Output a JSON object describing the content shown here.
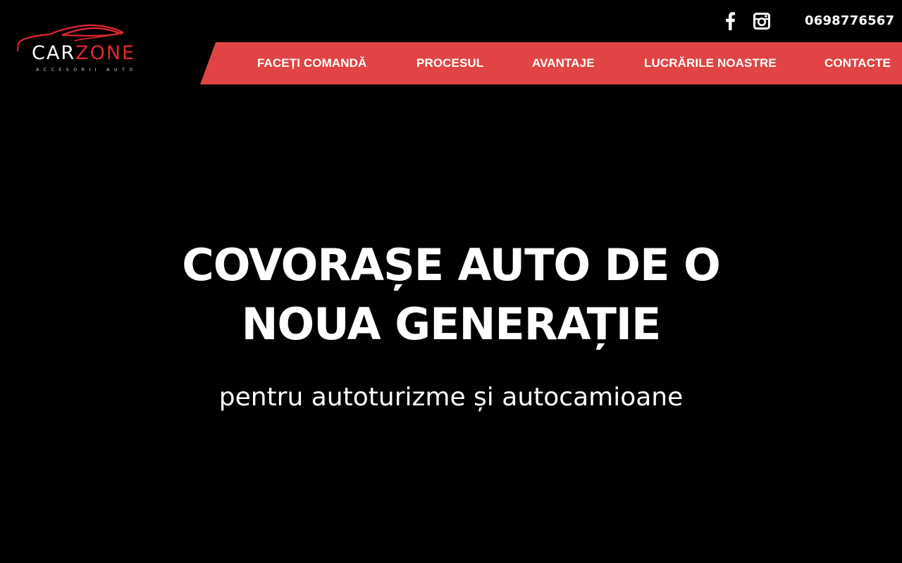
{
  "brand": {
    "name_part1": "CAR",
    "name_part2": "ZONE",
    "tagline": "ACCESORII AUTO",
    "accent_color": "#e3262f"
  },
  "header": {
    "social": [
      {
        "name": "facebook",
        "icon": "facebook-icon"
      },
      {
        "name": "instagram",
        "icon": "instagram-icon"
      }
    ],
    "phone": "0698776567"
  },
  "nav": {
    "background": "#e04444",
    "items": [
      {
        "label": "FACEȚI COMANDĂ"
      },
      {
        "label": "PROCESUL"
      },
      {
        "label": "AVANTAJE"
      },
      {
        "label": "LUCRĂRILE NOASTRE"
      },
      {
        "label": "CONTACTE"
      }
    ]
  },
  "hero": {
    "title_line1": "COVORAȘE AUTO DE O",
    "title_line2": "NOUA GENERAȚIE",
    "subtitle": "pentru autoturizme și autocamioane"
  }
}
